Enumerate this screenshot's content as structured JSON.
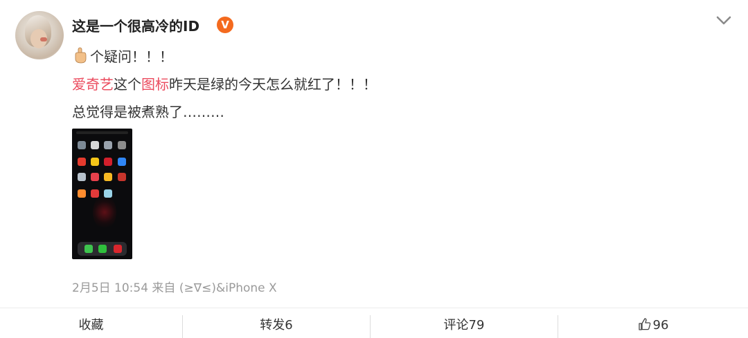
{
  "post": {
    "username": "这是一个很高冷的ID",
    "verified_badge": "V",
    "lines": {
      "line1_text": "个疑问！！！",
      "line2_link1": "爱奇艺",
      "line2_mid": "这个",
      "line2_link2": "图标",
      "line2_rest": "昨天是绿的今天怎么就红了！！！",
      "line3_text": "总觉得是被煮熟了………"
    },
    "meta": "2月5日 10:54 来自 (≥∇≤)&iPhone X"
  },
  "actions": {
    "favorite": "收藏",
    "repost": "转发6",
    "comment": "评论79",
    "like_count": "96"
  },
  "colors": {
    "link": "#eb4b5e",
    "badge": "#f46a1e",
    "meta": "#9a9a9a"
  },
  "icons": [
    "chevron-down-icon",
    "pointing-up-emoji",
    "verified-badge",
    "thumbs-up-icon"
  ]
}
